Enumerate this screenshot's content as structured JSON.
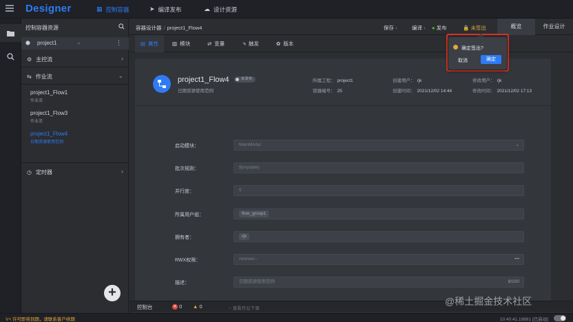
{
  "app": {
    "brand": "Designer"
  },
  "topnav": [
    {
      "label": "控制容器",
      "icon": "grid-icon",
      "active": true
    },
    {
      "label": "编译发布",
      "icon": "send-icon",
      "active": false
    },
    {
      "label": "设计资源",
      "icon": "cloud-icon",
      "active": false
    }
  ],
  "sidebar": {
    "title": "控制容器资源",
    "project": "project1",
    "main_flow": "主控流",
    "job_flow": "作业流",
    "flows": [
      {
        "name": "project1_Flow1",
        "sub": "作业流"
      },
      {
        "name": "project1_Flow3",
        "sub": "作业流"
      },
      {
        "name": "project1_Flow4",
        "sub": "日期资源使用范例"
      }
    ],
    "timer": "定时器"
  },
  "header": {
    "crumb_root": "容器设计器",
    "crumb_current": "project1_Flow4",
    "actions": {
      "save": "保存",
      "compile": "编译",
      "publish": "发布",
      "checkout": "未签出"
    },
    "tabs": [
      "概览",
      "作业设计"
    ]
  },
  "tabs": [
    "属性",
    "模块",
    "变量",
    "触发",
    "版本"
  ],
  "detail": {
    "name": "project1_Flow4",
    "status": "未发布",
    "desc": "日期资源使用范例",
    "project_label": "所属工程：",
    "project": "project1",
    "container_label": "容器编号：",
    "container": "25",
    "creator_label": "创建用户：",
    "creator": "rjk",
    "created_label": "创建时间：",
    "created": "2021/12/02 14:44",
    "modifier_label": "修改用户：",
    "modifier": "rjk",
    "modified_label": "修改时间：",
    "modified": "2021/12/02 17:13"
  },
  "form": {
    "start_module_label": "启动模块：",
    "start_module": "MainModul",
    "batch_rule_label": "批次规则：",
    "batch_rule": "${mydate}",
    "parallel_label": "并行度：",
    "parallel": "5",
    "group_label": "所属用户组：",
    "group": "flow_group1",
    "owner_label": "拥有者：",
    "owner": "rjk",
    "rwx_label": "RWX权限：",
    "rwx": "rwxrwxr--",
    "desc_label": "描述：",
    "desc": "日期资源使用范例",
    "desc_count": "8/100"
  },
  "console": {
    "label": "控制台",
    "errors": "0",
    "warnings": "0",
    "placeholder": "查看作业下录"
  },
  "status": {
    "warning": "V+ 许可即将到期，请联系客户续期",
    "time": "10:40:41.19881",
    "state": "[已启动]"
  },
  "popconfirm": {
    "title": "确定签出?",
    "cancel": "取消",
    "ok": "确定"
  },
  "watermark": "@稀土掘金技术社区",
  "colors": {
    "accent": "#2f7bf5",
    "warning": "#e0a83b",
    "highlight": "#d9331f"
  }
}
